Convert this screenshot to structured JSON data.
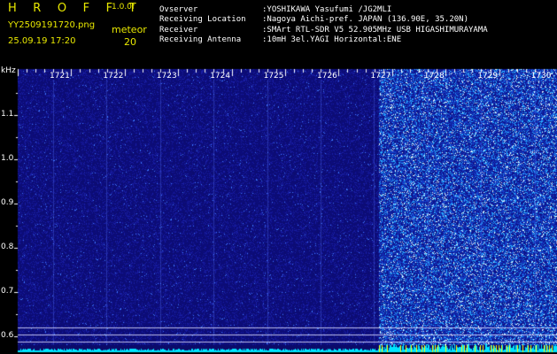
{
  "header": {
    "app_title": "H R O F F T",
    "app_version": "1.0.0f",
    "file_name": "YY2509191720.png",
    "datetime": "25.09.19 17:20",
    "meteor_label": "meteor",
    "meteor_count": "20"
  },
  "info": [
    {
      "label": "Ovserver",
      "value": ":YOSHIKAWA Yasufumi /JG2MLI"
    },
    {
      "label": "Receiving Location",
      "value": ":Nagoya Aichi-pref. JAPAN (136.90E, 35.20N)"
    },
    {
      "label": "Receiver",
      "value": ":SMArt RTL-SDR V5 52.905MHz USB HIGASHIMURAYAMA"
    },
    {
      "label": "Receiving Antenna",
      "value": ":10mH 3el.YAGI Horizontal:ENE"
    }
  ],
  "spectrogram": {
    "unit": "kHz",
    "time_ticks": [
      "1721",
      "1722",
      "1723",
      "1724",
      "1725",
      "1726",
      "1727",
      "1728",
      "1729",
      "1730"
    ],
    "freq_ticks": [
      "1.1",
      "1.0",
      "0.9",
      "0.8",
      "0.7",
      "0.6"
    ],
    "freq_values": [
      1.1,
      1.0,
      0.9,
      0.8,
      0.7,
      0.6
    ],
    "colors": {
      "background": "#0b0b6a",
      "noise_low": "#1a1ab0",
      "noise_high": "#3aa0ff",
      "hot": "#e8ffff",
      "bottom_trace": "#00e5ff",
      "meteor_marker": "#ffff00",
      "grid": "#ffffff",
      "text": "#ffffff",
      "accent_text": "#e8e800"
    }
  }
}
